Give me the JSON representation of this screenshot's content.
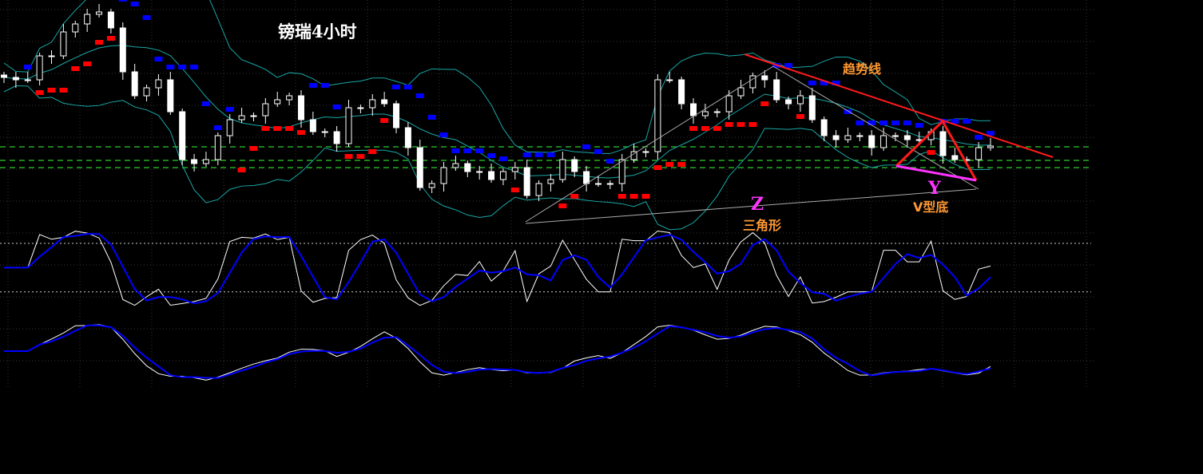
{
  "chart_data": {
    "type": "candlestick",
    "title": "镑瑞4小时",
    "xlabel": "",
    "ylabel": "",
    "grid": true,
    "price_units": "relative",
    "closes": [
      203,
      200,
      200,
      230,
      230,
      260,
      270,
      282,
      285,
      265,
      210,
      180,
      190,
      200,
      160,
      100,
      95,
      100,
      130,
      150,
      155,
      155,
      170,
      175,
      180,
      150,
      135,
      135,
      120,
      165,
      165,
      175,
      170,
      140,
      115,
      65,
      70,
      90,
      95,
      85,
      85,
      75,
      85,
      90,
      55,
      70,
      75,
      100,
      85,
      70,
      70,
      70,
      100,
      110,
      110,
      200,
      200,
      170,
      155,
      160,
      160,
      180,
      190,
      205,
      200,
      175,
      170,
      180,
      150,
      130,
      125,
      130,
      130,
      115,
      130,
      130,
      125,
      125,
      135,
      105,
      100,
      100,
      115,
      117
    ],
    "ylim": [
      0,
      300
    ],
    "support_levels": [
      116,
      99,
      90
    ],
    "indicators": {
      "bollinger": {
        "period": 10,
        "std": 2,
        "color": "#1aa6a6"
      },
      "sar": {
        "up_color": "#ff0000",
        "down_color": "#0000ff"
      },
      "oscillator_fast": {
        "k_period": 5,
        "d_period": 3,
        "levels": [
          80,
          20
        ],
        "k_color": "#ffffff",
        "d_color": "#0000ff"
      },
      "oscillator_slow": {
        "k_period": 14,
        "d_period": 5,
        "k_color": "#ffffff",
        "d_color": "#0000ff"
      }
    },
    "annotations": {
      "trendline_label": "趋势线",
      "z_label": "Z",
      "triangle_label": "三角形",
      "y_label": "Y",
      "v_bottom_label": "V型底"
    }
  }
}
